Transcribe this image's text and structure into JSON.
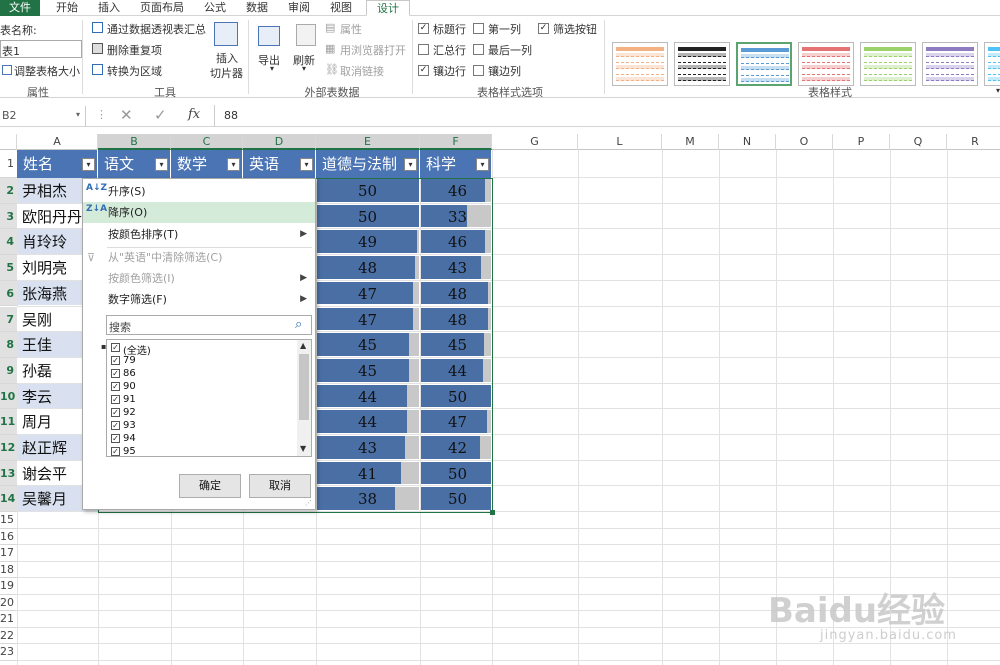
{
  "tabs": [
    "文件",
    "开始",
    "插入",
    "页面布局",
    "公式",
    "数据",
    "审阅",
    "视图",
    "设计"
  ],
  "ribbon": {
    "props": {
      "name_label": "表名称:",
      "name_value": "表1",
      "resize": "调整表格大小",
      "group": "属性"
    },
    "tools": {
      "pivot": "通过数据透视表汇总",
      "dedupe": "删除重复项",
      "convert": "转换为区域",
      "slicer_l1": "插入",
      "slicer_l2": "切片器",
      "group": "工具"
    },
    "ext": {
      "export": "导出",
      "refresh": "刷新",
      "properties": "属性",
      "open_browser": "用浏览器打开",
      "unlink": "取消链接",
      "group": "外部表数据"
    },
    "opts": {
      "header_row": "标题行",
      "first_col": "第一列",
      "filter_btn": "筛选按钮",
      "total_row": "汇总行",
      "last_col": "最后一列",
      "banded_rows": "镶边行",
      "banded_cols": "镶边列",
      "group": "表格样式选项"
    },
    "styles": {
      "group": "表格样式"
    }
  },
  "formula": {
    "namebox": "B2",
    "value": "88",
    "fx": "fx"
  },
  "columns": [
    "A",
    "B",
    "C",
    "D",
    "E",
    "F",
    "G",
    "L",
    "M",
    "N",
    "O",
    "P",
    "Q",
    "R"
  ],
  "rows": [
    "1",
    "2",
    "3",
    "4",
    "5",
    "6",
    "7",
    "8",
    "9",
    "10",
    "11",
    "12",
    "13",
    "14",
    "15",
    "16",
    "17",
    "18",
    "19",
    "20",
    "21",
    "22",
    "23"
  ],
  "headers": [
    "姓名",
    "语文",
    "数学",
    "英语",
    "道德与法制",
    "科学"
  ],
  "names": [
    "尹相杰",
    "欧阳丹丹",
    "肖玲玲",
    "刘明亮",
    "张海燕",
    "吴刚",
    "王佳",
    "孙磊",
    "李云",
    "周月",
    "赵正辉",
    "谢会平",
    "吴馨月"
  ],
  "morals": [
    50,
    50,
    49,
    48,
    47,
    47,
    45,
    45,
    44,
    44,
    43,
    41,
    38
  ],
  "science": [
    46,
    33,
    46,
    43,
    48,
    48,
    45,
    44,
    50,
    47,
    42,
    50,
    50
  ],
  "menu": {
    "asc": "升序(S)",
    "desc": "降序(O)",
    "sort_color": "按颜色排序(T)",
    "clear": "从\"英语\"中清除筛选(C)",
    "filter_color": "按颜色筛选(I)",
    "num_filter": "数字筛选(F)",
    "search_placeholder": "搜索",
    "list": [
      "(全选)",
      "79",
      "86",
      "90",
      "91",
      "92",
      "93",
      "94",
      "95"
    ],
    "ok": "确定",
    "cancel": "取消"
  },
  "watermark": {
    "l1": "Baidu经验",
    "l2": "jingyan.baidu.com"
  },
  "colors": {
    "accent": "#217346",
    "header": "#4a74b4",
    "bar": "#4a6fa5",
    "highlight": "#d5ebd9"
  }
}
